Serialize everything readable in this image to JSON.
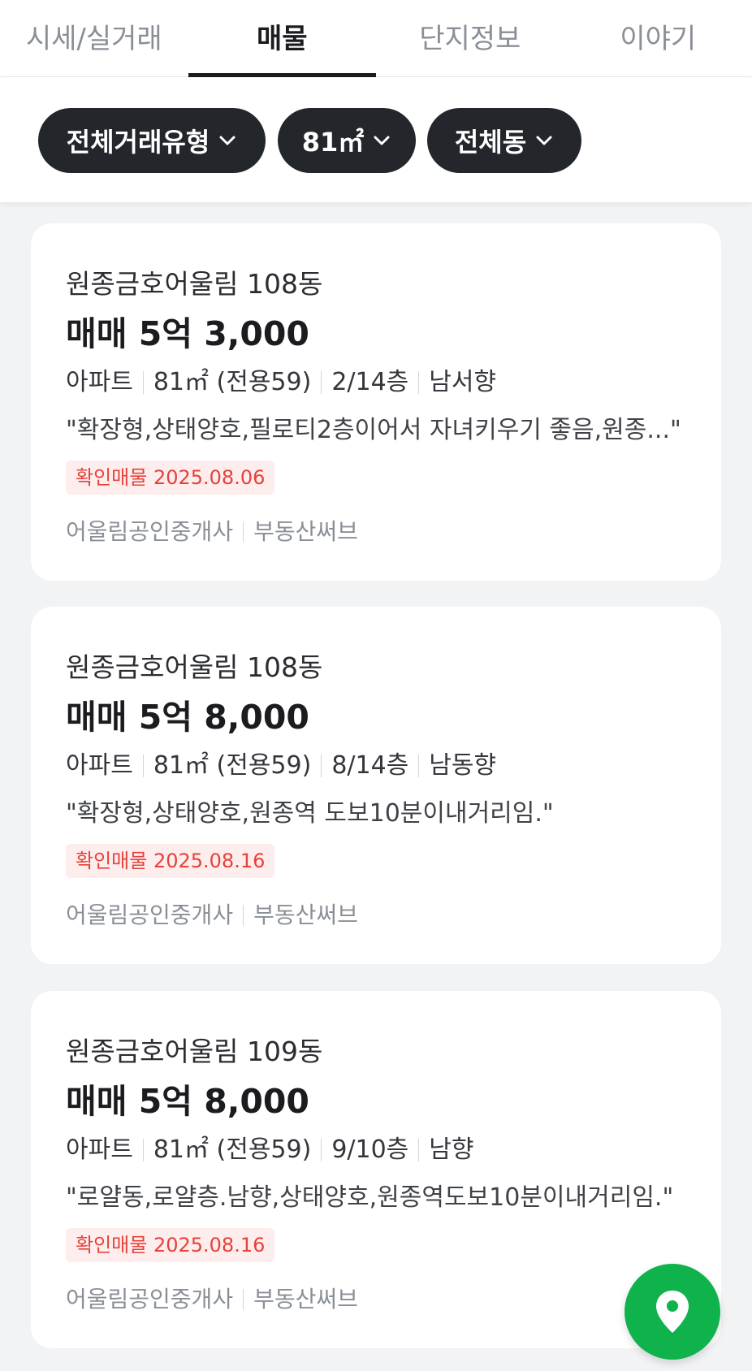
{
  "tabs": [
    {
      "label": "시세/실거래",
      "active": false
    },
    {
      "label": "매물",
      "active": true
    },
    {
      "label": "단지정보",
      "active": false
    },
    {
      "label": "이야기",
      "active": false
    }
  ],
  "filters": {
    "deal_type": "전체거래유형",
    "area": "81㎡",
    "dong": "전체동"
  },
  "listings": [
    {
      "complex": "원종금호어울림 108동",
      "price": "매매 5억 3,000",
      "type": "아파트",
      "area": "81㎡ (전용59)",
      "floor": "2/14층",
      "direction": "남서향",
      "description": "\"확장형,상태양호,필로티2층이어서 자녀키우기 좋음,원종...\"",
      "badge": "확인매물 2025.08.06",
      "agency": "어울림공인중개사",
      "provider": "부동산써브"
    },
    {
      "complex": "원종금호어울림 108동",
      "price": "매매 5억 8,000",
      "type": "아파트",
      "area": "81㎡ (전용59)",
      "floor": "8/14층",
      "direction": "남동향",
      "description": "\"확장형,상태양호,원종역 도보10분이내거리임.\"",
      "badge": "확인매물 2025.08.16",
      "agency": "어울림공인중개사",
      "provider": "부동산써브"
    },
    {
      "complex": "원종금호어울림 109동",
      "price": "매매 5억 8,000",
      "type": "아파트",
      "area": "81㎡ (전용59)",
      "floor": "9/10층",
      "direction": "남향",
      "description": "\"로얄동,로얄층.남향,상태양호,원종역도보10분이내거리임.\"",
      "badge": "확인매물 2025.08.16",
      "agency": "어울림공인중개사",
      "provider": "부동산써브"
    }
  ],
  "map_button": {
    "icon": "map-pin-icon",
    "color": "#10b24b"
  }
}
